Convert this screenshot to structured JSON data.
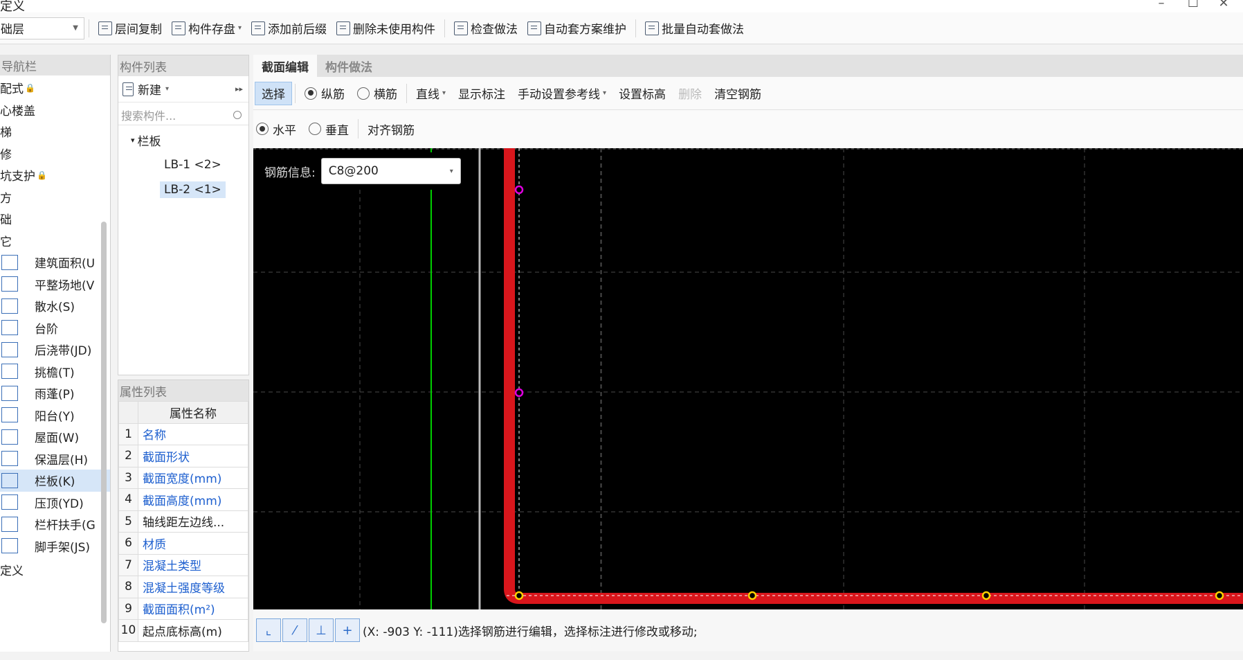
{
  "window": {
    "title": "定义",
    "min": "–",
    "max": "☐",
    "close": "✕"
  },
  "toolbar": {
    "floor": "础层",
    "buttons": [
      {
        "label": "层间复制",
        "icon": "copy-floor-icon"
      },
      {
        "label": "构件存盘",
        "icon": "save-component-icon",
        "dropdown": "▾"
      },
      {
        "label": "添加前后缀",
        "icon": "add-prefix-icon"
      },
      {
        "label": "删除未使用构件",
        "icon": "delete-unused-icon"
      },
      {
        "label": "检查做法",
        "icon": "check-method-icon"
      },
      {
        "label": "自动套方案维护",
        "icon": "auto-scheme-icon"
      },
      {
        "label": "批量自动套做法",
        "icon": "batch-auto-icon"
      }
    ]
  },
  "nav": {
    "header": "导航栏",
    "items": [
      {
        "label": "配式",
        "lock": "🔒"
      },
      {
        "label": "心楼盖"
      },
      {
        "label": "梯"
      },
      {
        "label": "修"
      },
      {
        "label": "坑支护",
        "lock": "🔒"
      },
      {
        "label": "方"
      },
      {
        "label": "础"
      },
      {
        "label": "它"
      },
      {
        "label": "建筑面积(U",
        "icon": "area-icon"
      },
      {
        "label": "平整场地(V",
        "icon": "level-site-icon"
      },
      {
        "label": "散水(S)",
        "icon": "apron-icon"
      },
      {
        "label": "台阶",
        "icon": "steps-icon"
      },
      {
        "label": "后浇带(JD)",
        "icon": "post-pour-icon"
      },
      {
        "label": "挑檐(T)",
        "icon": "eave-icon"
      },
      {
        "label": "雨蓬(P)",
        "icon": "canopy-icon"
      },
      {
        "label": "阳台(Y)",
        "icon": "balcony-icon"
      },
      {
        "label": "屋面(W)",
        "icon": "roof-icon"
      },
      {
        "label": "保温层(H)",
        "icon": "insulation-icon"
      },
      {
        "label": "栏板(K)",
        "icon": "parapet-icon",
        "selected": true
      },
      {
        "label": "压顶(YD)",
        "icon": "coping-icon"
      },
      {
        "label": "栏杆扶手(G",
        "icon": "railing-icon"
      },
      {
        "label": "脚手架(JS)",
        "icon": "scaffold-icon"
      }
    ],
    "footer": "定义"
  },
  "complist": {
    "header": "构件列表",
    "new_label": "新建",
    "new_caret": "▾",
    "more": "▸▸",
    "search_placeholder": "搜索构件...",
    "tree_root": "栏板",
    "tree_toggle": "▾",
    "items": [
      {
        "label": "LB-1 <2>"
      },
      {
        "label": "LB-2 <1>",
        "selected": true
      }
    ]
  },
  "props": {
    "header": "属性列表",
    "col_name": "属性名称",
    "rows": [
      {
        "num": "1",
        "name": "名称",
        "blue": true
      },
      {
        "num": "2",
        "name": "截面形状",
        "blue": true
      },
      {
        "num": "3",
        "name": "截面宽度(mm)",
        "blue": true
      },
      {
        "num": "4",
        "name": "截面高度(mm)",
        "blue": true
      },
      {
        "num": "5",
        "name": "轴线距左边线...",
        "blue": false
      },
      {
        "num": "6",
        "name": "材质",
        "blue": true
      },
      {
        "num": "7",
        "name": "混凝土类型",
        "blue": true
      },
      {
        "num": "8",
        "name": "混凝土强度等级",
        "blue": true
      },
      {
        "num": "9",
        "name": "截面面积(m²)",
        "blue": true
      },
      {
        "num": "10",
        "name": "起点底标高(m)",
        "blue": false
      }
    ]
  },
  "editor": {
    "tabs": [
      {
        "label": "截面编辑",
        "active": true
      },
      {
        "label": "构件做法",
        "active": false
      }
    ],
    "row1": {
      "select": "选择",
      "radio_long": "纵筋",
      "radio_stir": "横筋",
      "line": "直线",
      "show_dim": "显示标注",
      "manual_ref": "手动设置参考线",
      "set_elev": "设置标高",
      "delete": "删除",
      "clear": "清空钢筋"
    },
    "row2": {
      "horizontal": "水平",
      "vertical": "垂直",
      "align": "对齐钢筋"
    },
    "rebar_label": "钢筋信息:",
    "rebar_value": "C8@200",
    "status": "(X: -903 Y: -111)选择钢筋进行编辑，选择标注进行修改或移动;",
    "colors": {
      "canvas": "#000000",
      "section": "#d9161c",
      "green": "#00d000",
      "magenta": "#e000e0",
      "yellow": "#ffd200",
      "grid": "#4a4a4a"
    }
  }
}
